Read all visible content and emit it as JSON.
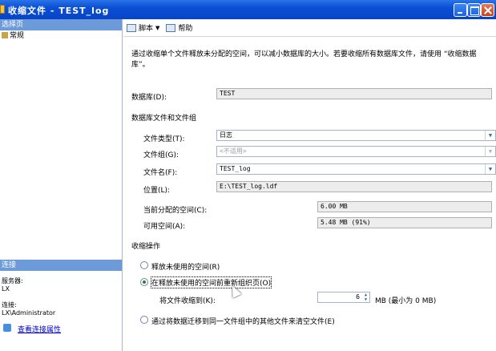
{
  "window": {
    "title": "收缩文件 - TEST_log",
    "minimize_label": "_",
    "maximize_label": "□",
    "close_label": "X"
  },
  "left_panel": {
    "select_page_header": "选择页",
    "pages": [
      {
        "label": "常规",
        "icon": "general-page-icon"
      }
    ],
    "connection_header": "连接",
    "server_label": "服务器:",
    "server_value": "LX",
    "connection_label": "连接:",
    "connection_value": "LX\\Administrator",
    "view_connection_link": "查看连接属性"
  },
  "toolbar": {
    "script_label": "脚本",
    "help_label": "帮助"
  },
  "description": "通过收缩单个文件释放未分配的空间，可以减小数据库的大小。若要收缩所有数据库文件，请使用 “收缩数据库”。",
  "form": {
    "database_label": "数据库(D):",
    "database_value": "TEST",
    "files_group_label": "数据库文件和文件组",
    "file_type_label": "文件类型(T):",
    "file_type_value": "日志",
    "filegroup_label": "文件组(G):",
    "filegroup_value": "<不适用>",
    "file_name_label": "文件名(F):",
    "file_name_value": "TEST_log",
    "location_label": "位置(L):",
    "location_value": "E:\\TEST_log.ldf",
    "allocated_label": "当前分配的空间(C):",
    "allocated_value": "6.00 MB",
    "available_label": "可用空间(A):",
    "available_value": "5.48 MB (91%)"
  },
  "shrink": {
    "section_label": "收缩操作",
    "option1_label": "释放未使用的空间(R)",
    "option2_label": "在释放未使用的空间前重新组织页(O)",
    "shrink_to_label": "将文件收缩到(K):",
    "shrink_to_value": "6",
    "shrink_to_unit": "MB (最小为 0 MB)",
    "option3_label": "通过将数据迁移到同一文件组中的其他文件来清空文件(E)",
    "selected_option": 2
  }
}
